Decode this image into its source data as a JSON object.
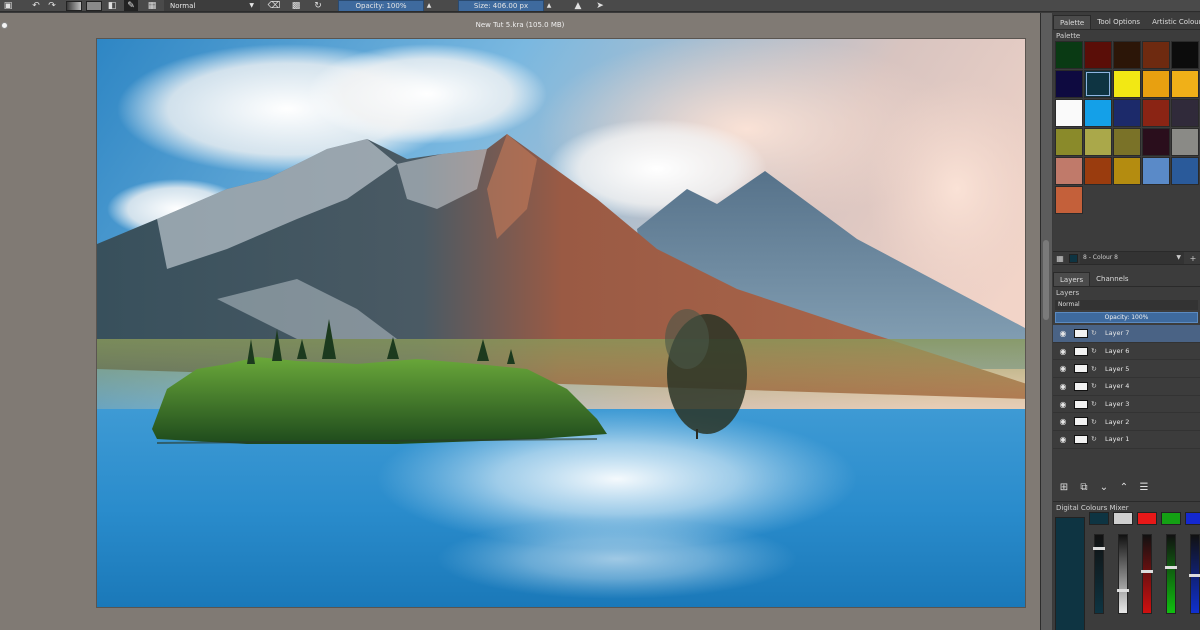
{
  "toolbar": {
    "blend_mode": "Normal",
    "opacity_label": "Opacity: 100%",
    "size_label": "Size: 406.00 px",
    "icons": [
      "save-icon",
      "undo-icon",
      "redo-icon",
      "gradient-icon",
      "swap-colors-icon",
      "brush-preset-icon",
      "grid-icon",
      "eraser-icon",
      "preserve-alpha-icon",
      "reload-icon",
      "mirror-icon",
      "wrap-icon"
    ]
  },
  "document": {
    "title": "New Tut 5.kra (105.0 MB)"
  },
  "docker": {
    "tabs": [
      "Palette",
      "Tool Options",
      "Artistic Colour S"
    ],
    "palette_title": "Palette",
    "palette_colors": [
      "#0a3a14",
      "#5a0e08",
      "#2c1608",
      "#6e2a10",
      "#0c0c0c",
      "#0e0a40",
      "#0e3442",
      "#f2e814",
      "#e8a010",
      "#f0b018",
      "#fafafa",
      "#14a0e8",
      "#1c2a6a",
      "#8a2414",
      "#302a3a",
      "#8a8a2a",
      "#aaa84a",
      "#7a7228",
      "#2a0e1c",
      "#8a8a86",
      "#c07a6a",
      "#9a3c0e",
      "#b48c10",
      "#5a8ac8",
      "#2a5a9a",
      "#c4603a"
    ],
    "selected_color_label": "8 - Colour 8",
    "layers_tabs": [
      "Layers",
      "Channels"
    ],
    "layers_title": "Layers",
    "layers_blend": "Normal",
    "layers_opacity": "Opacity: 100%",
    "layers": [
      {
        "name": "Layer 7",
        "selected": true
      },
      {
        "name": "Layer 6",
        "selected": false
      },
      {
        "name": "Layer 5",
        "selected": false
      },
      {
        "name": "Layer 4",
        "selected": false
      },
      {
        "name": "Layer 3",
        "selected": false
      },
      {
        "name": "Layer 2",
        "selected": false
      },
      {
        "name": "Layer 1",
        "selected": false
      }
    ],
    "mixer_title": "Digital Colours Mixer",
    "mixer_current": "#0e3442",
    "mixer_channels": [
      {
        "top": "#0e3442",
        "slider": "#0e3442",
        "level": 0.85
      },
      {
        "top": "#cfcfcf",
        "slider": "#e8e8e8",
        "level": 0.3
      },
      {
        "top": "#e81818",
        "slider": "#d01010",
        "level": 0.55
      },
      {
        "top": "#14a014",
        "slider": "#10c010",
        "level": 0.6
      },
      {
        "top": "#1428d0",
        "slider": "#1030d0",
        "level": 0.5
      }
    ]
  }
}
